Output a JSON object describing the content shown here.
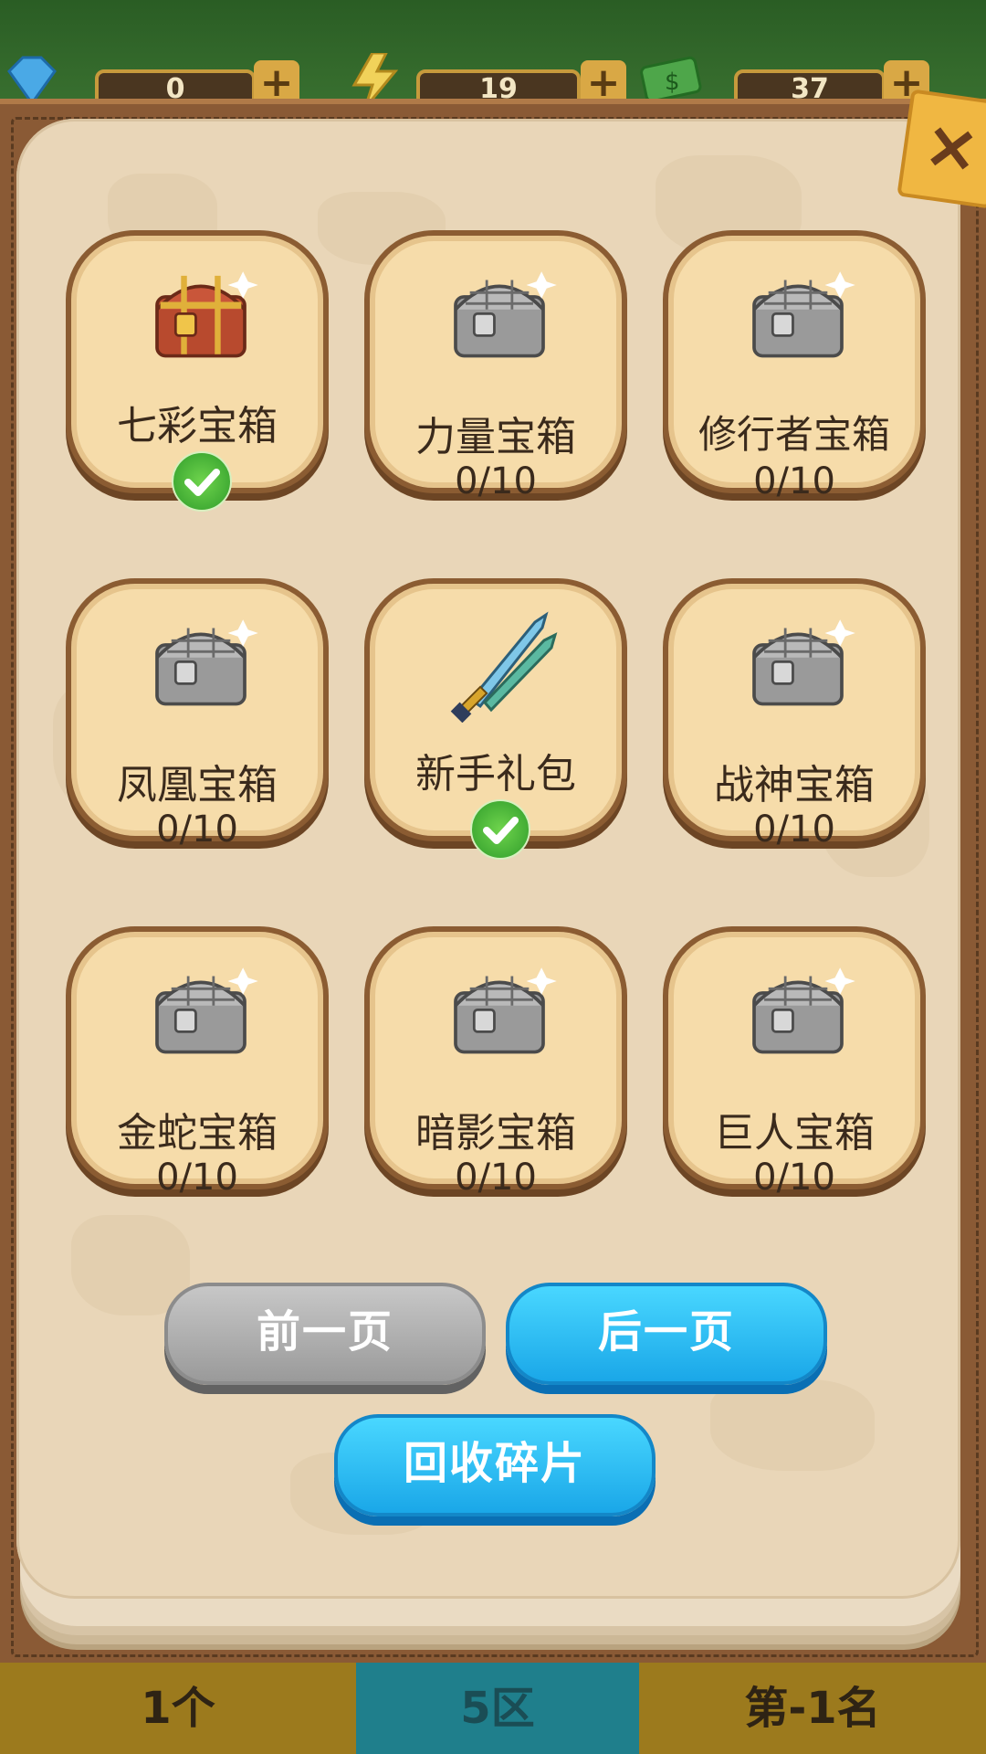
{
  "top_bar": {
    "gems": {
      "icon": "gem-icon",
      "value": "0",
      "plus": "+"
    },
    "energy": {
      "icon": "lightning-icon",
      "value": "19",
      "plus": "+"
    },
    "cash": {
      "icon": "cash-icon",
      "value": "37",
      "plus": "+"
    }
  },
  "close_button": {
    "icon": "close-icon",
    "label": "×"
  },
  "cards": [
    {
      "name": "七彩宝箱",
      "count": "",
      "claimed": true,
      "icon": "gold-chest-icon"
    },
    {
      "name": "力量宝箱",
      "count": "0/10",
      "claimed": false,
      "icon": "silver-chest-icon"
    },
    {
      "name": "修行者宝箱",
      "count": "0/10",
      "claimed": false,
      "icon": "silver-chest-icon"
    },
    {
      "name": "凤凰宝箱",
      "count": "0/10",
      "claimed": false,
      "icon": "silver-chest-icon"
    },
    {
      "name": "新手礼包",
      "count": "",
      "claimed": true,
      "icon": "sword-icon"
    },
    {
      "name": "战神宝箱",
      "count": "0/10",
      "claimed": false,
      "icon": "silver-chest-icon"
    },
    {
      "name": "金蛇宝箱",
      "count": "0/10",
      "claimed": false,
      "icon": "silver-chest-icon"
    },
    {
      "name": "暗影宝箱",
      "count": "0/10",
      "claimed": false,
      "icon": "silver-chest-icon"
    },
    {
      "name": "巨人宝箱",
      "count": "0/10",
      "claimed": false,
      "icon": "silver-chest-icon"
    }
  ],
  "buttons": {
    "prev": "前一页",
    "next": "后一页",
    "recycle": "回收碎片"
  },
  "bottom_bar": {
    "left": "1个",
    "middle": "5区",
    "right": "第-1名"
  },
  "colors": {
    "button_blue": "#1aa7e8",
    "button_gray": "#9a9a9a",
    "card_fill": "#f6dcaa",
    "check_green": "#2f9c2a"
  }
}
